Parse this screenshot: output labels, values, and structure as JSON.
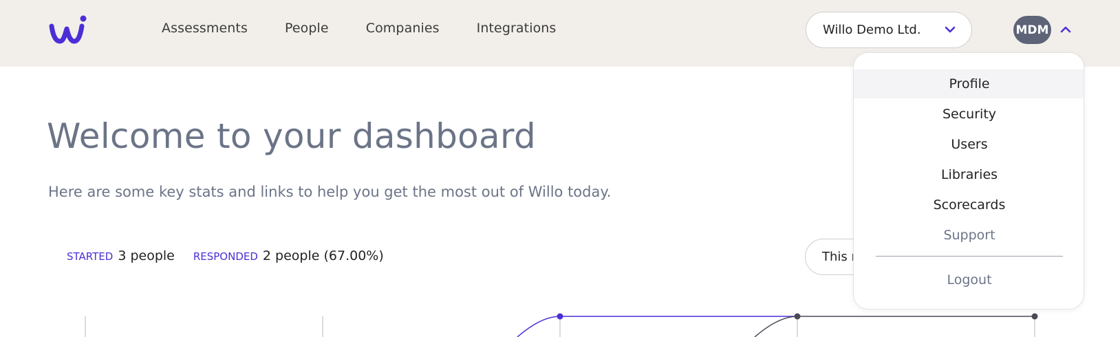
{
  "header": {
    "logo_icon": "willo-logo-icon",
    "nav": [
      {
        "label": "Assessments"
      },
      {
        "label": "People"
      },
      {
        "label": "Companies"
      },
      {
        "label": "Integrations"
      }
    ],
    "company_select": {
      "value": "Willo Demo Ltd.",
      "icon": "chevron-down-icon"
    },
    "avatar": {
      "initials": "MDM",
      "icon": "chevron-up-icon"
    }
  },
  "colors": {
    "accent": "#4b2fd6",
    "topbar": "#f2efeb",
    "heading": "#6b7487",
    "avatar": "#5d6478"
  },
  "main": {
    "title": "Welcome to your dashboard",
    "subtitle": "Here are some key stats and links to help you get the most out of Willo today.",
    "stats": {
      "started_label": "STARTED",
      "started_value": "3 people",
      "responded_label": "RESPONDED",
      "responded_value": "2 people (67.00%)"
    },
    "period_select": {
      "value": "This m"
    }
  },
  "user_menu": {
    "items": [
      {
        "label": "Profile"
      },
      {
        "label": "Security"
      },
      {
        "label": "Users"
      },
      {
        "label": "Libraries"
      },
      {
        "label": "Scorecards"
      },
      {
        "label": "Support"
      }
    ],
    "logout": "Logout"
  }
}
